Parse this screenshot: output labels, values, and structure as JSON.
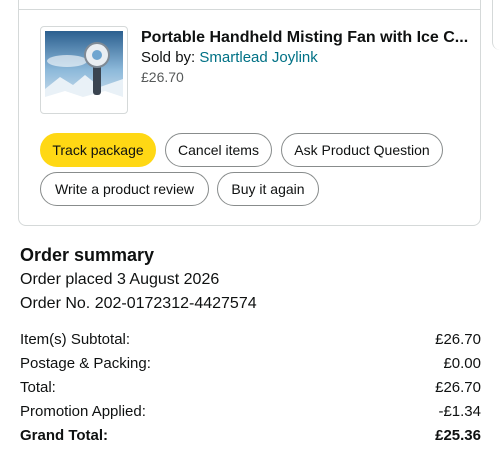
{
  "product": {
    "title": "Portable Handheld Misting Fan with Ice C...",
    "sold_by_prefix": "Sold by: ",
    "seller": "Smartlead Joylink",
    "price": "£26.70"
  },
  "actions": {
    "track_package": "Track package",
    "cancel_items": "Cancel items",
    "ask_question": "Ask Product Question",
    "write_review": "Write a product review",
    "buy_again": "Buy it again"
  },
  "summary": {
    "title": "Order summary",
    "order_placed": "Order placed 3 August 2026",
    "order_no": "Order No. 202-0172312-4427574",
    "lines": [
      {
        "label": "Item(s) Subtotal:",
        "value": "£26.70"
      },
      {
        "label": "Postage & Packing:",
        "value": "£0.00"
      },
      {
        "label": "Total:",
        "value": "£26.70"
      },
      {
        "label": "Promotion Applied:",
        "value": "-£1.34"
      },
      {
        "label": "Grand Total:",
        "value": "£25.36"
      }
    ]
  },
  "colors": {
    "primary_button": "#ffd814",
    "link": "#007185",
    "border": "#d5d9d9"
  }
}
